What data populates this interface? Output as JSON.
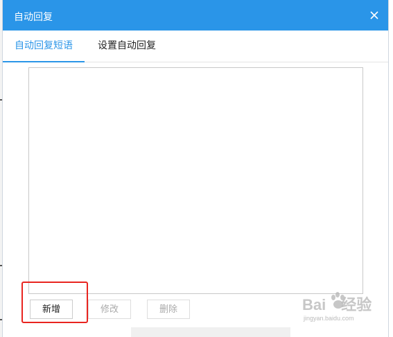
{
  "dialog": {
    "title": "自动回复"
  },
  "tabs": [
    {
      "label": "自动回复短语",
      "active": true
    },
    {
      "label": "设置自动回复",
      "active": false
    }
  ],
  "buttons": {
    "new_label": "新增",
    "edit_label": "修改",
    "delete_label": "删除"
  },
  "watermark": {
    "logo": "Bai",
    "logo_suffix": "经验",
    "url": "jingyan.baidu.com"
  },
  "colors": {
    "titlebar": "#2a95e8",
    "active_tab": "#2a95e8",
    "highlight": "#e8241f"
  },
  "icons": {
    "close": "close-icon"
  }
}
